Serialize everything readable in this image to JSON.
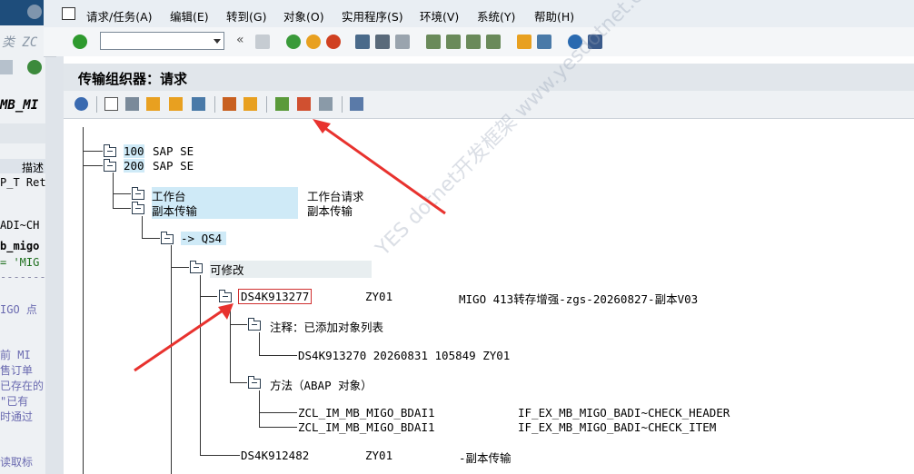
{
  "menubar": {
    "items": [
      "请求/任务(A)",
      "编辑(E)",
      "转到(G)",
      "对象(O)",
      "实用程序(S)",
      "环境(V)",
      "系统(Y)",
      "帮助(H)"
    ]
  },
  "page": {
    "title": "传输组织器：请求"
  },
  "tree": {
    "clients": [
      {
        "id": "100",
        "name": "SAP SE"
      },
      {
        "id": "200",
        "name": "SAP SE"
      }
    ],
    "workbench": {
      "label": "工作台",
      "desc": "工作台请求"
    },
    "transport_copy": {
      "label": "副本传输",
      "desc": "副本传输"
    },
    "target": "-> QS4",
    "modifiable": "可修改",
    "request": {
      "id": "DS4K913277",
      "owner": "ZY01",
      "desc": "MIGO 413转存增强-zgs-20260827-副本V03"
    },
    "comment": {
      "label": "注释：已添加对象列表",
      "line": "DS4K913270 20260831 105849 ZY01"
    },
    "methods": {
      "label": "方法（ABAP 对象）",
      "rows": [
        {
          "class": "ZCL_IM_MB_MIGO_BDAI1",
          "method": "IF_EX_MB_MIGO_BADI~CHECK_HEADER"
        },
        {
          "class": "ZCL_IM_MB_MIGO_BDAI1",
          "method": "IF_EX_MB_MIGO_BADI~CHECK_ITEM"
        }
      ]
    },
    "request2": {
      "id": "DS4K912482",
      "owner": "ZY01",
      "desc": "-副本传输"
    }
  },
  "watermark": "YES dotnet开发框架 www.yesdotnet.com",
  "background_window": {
    "fragments": [
      "类 ZC",
      "MB_MI",
      "描述",
      "P_T Ret",
      "ADI~CH",
      "b_migo",
      "= 'MIG",
      "IGO 点",
      "前 MI",
      "售订单",
      "已存在的",
      "\"已有",
      "时通过",
      "读取标"
    ]
  },
  "colors": {
    "highlight": "#cfeaf7",
    "arrow": "#e8322e"
  }
}
